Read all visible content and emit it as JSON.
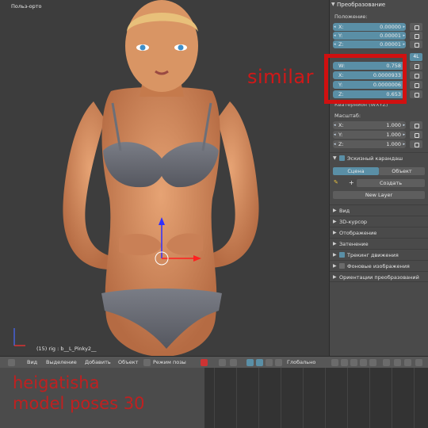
{
  "viewport": {
    "title": "Польз-орто",
    "rig_label": "(15) rig : b__L_Pinky2__"
  },
  "overlay": {
    "similar": "similar",
    "watermark_line1": "heigatisha",
    "watermark_line2": "model poses 30"
  },
  "panel": {
    "header": "Преобразование",
    "position_label": "Положение:",
    "position": [
      {
        "axis": "X:",
        "value": "0.00000"
      },
      {
        "axis": "Y:",
        "value": "0.00001"
      },
      {
        "axis": "Z:",
        "value": "0.00001"
      }
    ],
    "rotation_mode": "4L",
    "rotation": [
      {
        "axis": "W:",
        "value": "0.758"
      },
      {
        "axis": "X:",
        "value": "0.0000933"
      },
      {
        "axis": "Y:",
        "value": "0.0000006"
      },
      {
        "axis": "Z:",
        "value": "0.653"
      }
    ],
    "rotation_mode_label": "Кватернион (WXYZ)",
    "scale_label": "Масштаб:",
    "scale": [
      {
        "axis": "X:",
        "value": "1.000"
      },
      {
        "axis": "Y:",
        "value": "1.000"
      },
      {
        "axis": "Z:",
        "value": "1.000"
      }
    ],
    "grease_pencil": {
      "header": "Эскизный карандаш",
      "tab_scene": "Сцена",
      "tab_object": "Объект",
      "create": "Создать",
      "new_layer": "New Layer"
    },
    "collapsed": [
      {
        "label": "Вид"
      },
      {
        "label": "3D-курсор"
      },
      {
        "label": "Отображение"
      },
      {
        "label": "Затенение"
      },
      {
        "label": "Трекинг движения"
      },
      {
        "label": "Фоновые изображения"
      },
      {
        "label": "Ориентации преобразований"
      }
    ]
  },
  "bottom_bar": {
    "view": "Вид",
    "select": "Выделение",
    "add": "Добавить",
    "object": "Объект",
    "mode": "Режим позы",
    "orientation": "Глобально"
  },
  "colors": {
    "accent": "#5a8fa6",
    "highlight_red": "#d01010",
    "panel_bg": "#4a4a4a",
    "viewport_bg": "#3d3d3d"
  }
}
